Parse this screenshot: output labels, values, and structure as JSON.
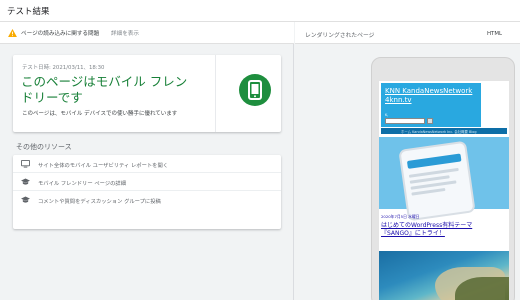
{
  "header": {
    "title": "テスト結果"
  },
  "issues": {
    "label": "ページの読み込みに関する問題",
    "details_link": "詳細を表示"
  },
  "result": {
    "date": "テスト日時: 2021/03/11、18:30",
    "headline_line1": "このページはモバイル フレン",
    "headline_line2": "ドリーです",
    "description": "このページは、モバイル デバイスでの使い勝手に優れています"
  },
  "resources": {
    "heading": "その他のリソース",
    "items": [
      {
        "icon": "monitor-icon",
        "label": "サイト全体のモバイル ユーザビリティ レポートを開く"
      },
      {
        "icon": "school-cap-icon",
        "label": "モバイル フレンドリー ページの詳細"
      },
      {
        "icon": "school-cap-icon",
        "label": "コメントや質問をディスカッション グループに投稿"
      }
    ]
  },
  "rendered": {
    "title": "レンダリングされたページ",
    "tab_html": "HTML",
    "site_title": "KNN KandaNewsNetwork 4knn.tv",
    "site_subtitle": "K,",
    "search_button": "検",
    "nav_text": "ホーム KandaNewsNetwork Inc. 会社概要 Blog",
    "post_date": "2020年7月5日 水曜日",
    "post_title": "はじめてのWordPress有料テーマ『SANGO』にトライ！"
  },
  "colors": {
    "success_green": "#188038",
    "badge_green": "#1e8e3e",
    "warning_yellow": "#f9ab00",
    "site_blue": "#29a8e0"
  }
}
